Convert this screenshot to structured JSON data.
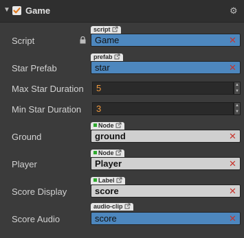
{
  "component": {
    "title": "Game",
    "enabled": true
  },
  "properties": [
    {
      "label": "Script",
      "tag": "script",
      "value": "Game",
      "kind": "asset",
      "locked": true
    },
    {
      "label": "Star Prefab",
      "tag": "prefab",
      "value": "star",
      "kind": "asset"
    },
    {
      "label": "Max Star Duration",
      "value": "5",
      "kind": "number"
    },
    {
      "label": "Min Star Duration",
      "value": "3",
      "kind": "number"
    },
    {
      "label": "Ground",
      "tag": "Node",
      "value": "ground",
      "kind": "node"
    },
    {
      "label": "Player",
      "tag": "Node",
      "value": "Player",
      "kind": "node"
    },
    {
      "label": "Score Display",
      "tag": "Label",
      "value": "score",
      "kind": "node"
    },
    {
      "label": "Score Audio",
      "tag": "audio-clip",
      "value": "score",
      "kind": "asset"
    }
  ],
  "icons": {
    "collapse": "triangle-down-icon",
    "settings": "gear-icon",
    "lock": "lock-icon",
    "clear": "close-icon",
    "open": "external-link-icon"
  },
  "colors": {
    "asset_field": "#4d87be",
    "node_field": "#d0d0d0",
    "number_text": "#f19a3e",
    "clear_icon": "#c8342c",
    "node_dot": "#2eaa2e"
  }
}
